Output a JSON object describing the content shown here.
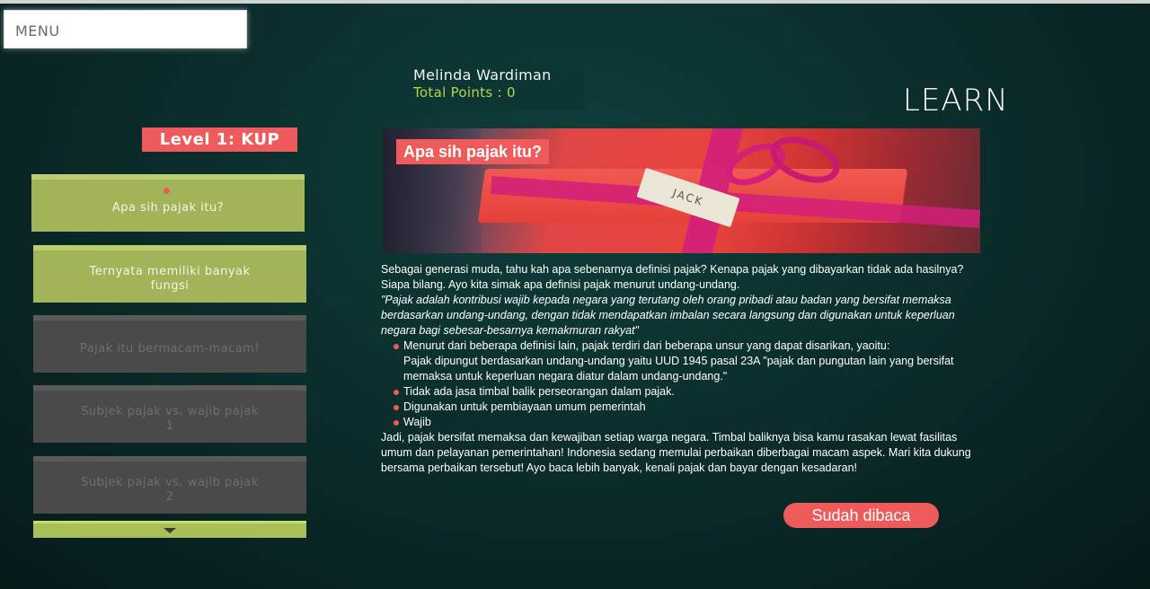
{
  "menu": {
    "label": "MENU"
  },
  "user": {
    "name": "Melinda Wardiman",
    "points": "Total Points : 0"
  },
  "page_title": "LEARN",
  "level": {
    "label": "Level 1: KUP"
  },
  "lessons": [
    {
      "label": "Apa sih pajak itu?",
      "state": "active"
    },
    {
      "label": "Ternyata memiliki banyak fungsi",
      "state": "active"
    },
    {
      "label": "Pajak itu bermacam-macam!",
      "state": "locked"
    },
    {
      "label": "Subjek pajak vs. wajib pajak 1",
      "state": "locked"
    },
    {
      "label": "Subjek pajak vs. wajib pajak 2",
      "state": "locked"
    }
  ],
  "article": {
    "title": "Apa sih pajak itu?",
    "image_tag": "JACK",
    "intro": "Sebagai generasi muda, tahu kah apa sebenarnya definisi pajak? Kenapa pajak yang dibayarkan tidak ada hasilnya? Siapa bilang. Ayo kita simak apa definisi pajak menurut undang-undang.",
    "quote": "\"Pajak adalah kontribusi wajib kepada negara yang terutang oleh orang pribadi atau badan yang bersifat memaksa berdasarkan undang-undang, dengan tidak mendapatkan imbalan secara langsung dan digunakan untuk keperluan negara bagi sebesar-besarnya kemakmuran rakyat\"",
    "bullets": [
      {
        "text": "Menurut dari beberapa definisi lain, pajak terdiri dari beberapa unsur yang dapat disarikan, yaoitu:",
        "sub": "Pajak dipungut berdasarkan undang-undang yaitu UUD 1945 pasal 23A \"pajak dan pungutan lain yang bersifat memaksa untuk keperluan negara diatur dalam undang-undang.\""
      },
      {
        "text": "Tidak ada jasa timbal balik perseorangan dalam pajak."
      },
      {
        "text": "Digunakan untuk pembiayaan umum pemerintah"
      },
      {
        "text": "Wajib"
      }
    ],
    "closing": "Jadi, pajak bersifat memaksa dan kewajiban setiap warga negara. Timbal baliknya bisa kamu rasakan lewat fasilitas umum dan pelayanan pemerintahan! Indonesia sedang memulai perbaikan diberbagai macam aspek. Mari kita dukung bersama perbaikan tersebut! Ayo baca lebih banyak, kenali pajak dan bayar dengan kesadaran!"
  },
  "done_button": {
    "label": "Sudah dibaca"
  },
  "colors": {
    "accent": "#ef5b5b",
    "lesson_active": "#a2b45a",
    "lesson_locked": "#4a4a4a",
    "points": "#b7d64a"
  }
}
